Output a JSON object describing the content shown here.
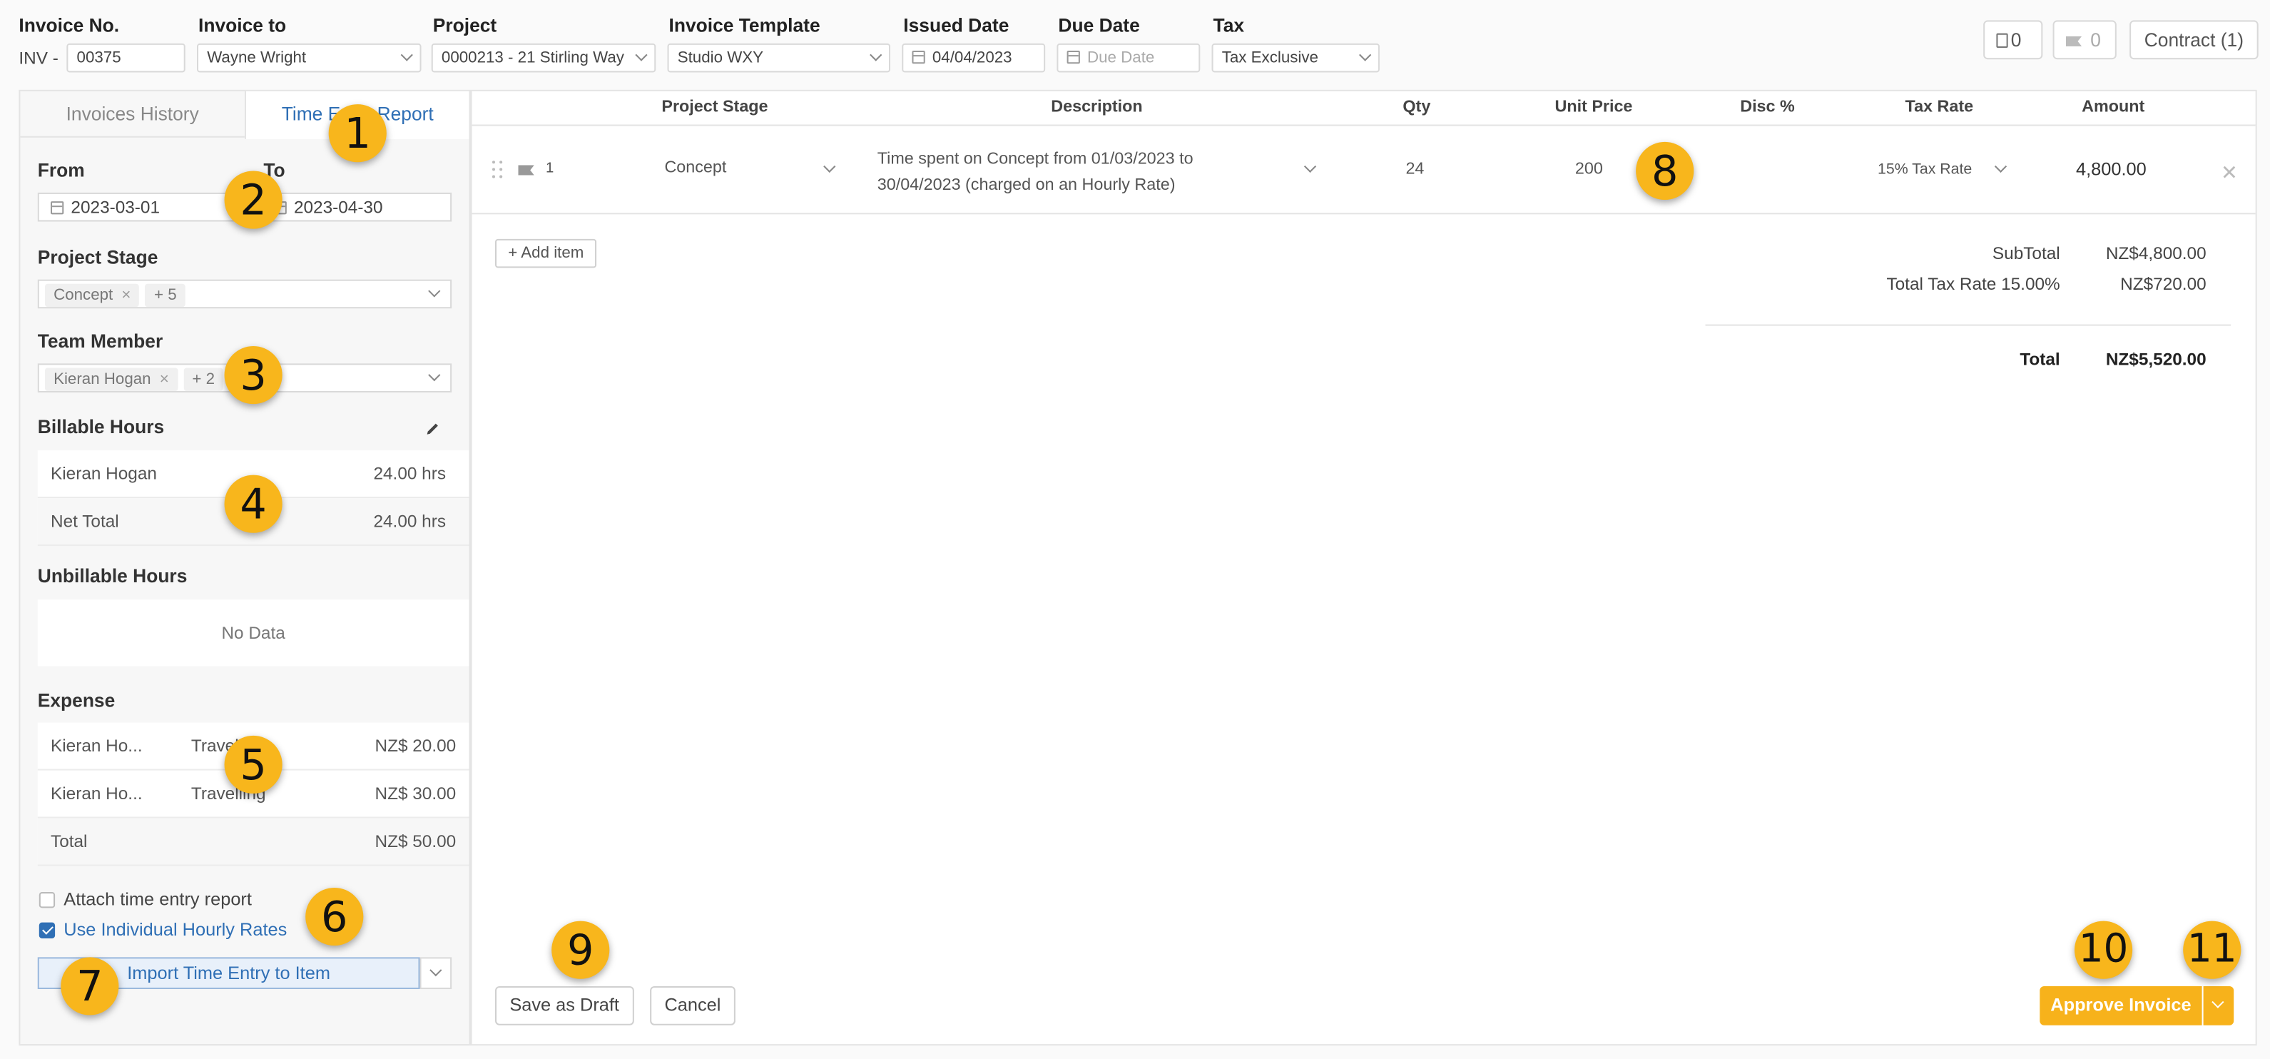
{
  "header": {
    "invoice_no_label": "Invoice No.",
    "invoice_prefix": "INV -",
    "invoice_no_value": "00375",
    "invoice_to_label": "Invoice to",
    "invoice_to_value": "Wayne Wright",
    "project_label": "Project",
    "project_value": "0000213 - 21 Stirling Way",
    "template_label": "Invoice Template",
    "template_value": "Studio WXY",
    "issued_label": "Issued Date",
    "issued_value": "04/04/2023",
    "due_label": "Due Date",
    "due_placeholder": "Due Date",
    "tax_label": "Tax",
    "tax_value": "Tax Exclusive",
    "doc_count": "0",
    "flag_count": "0",
    "contract_label": "Contract (1)"
  },
  "left": {
    "tabs": [
      "Invoices History",
      "Time Entry Report"
    ],
    "from_label": "From",
    "to_label": "To",
    "from_value": "2023-03-01",
    "to_value": "2023-04-30",
    "project_stage_label": "Project Stage",
    "project_stage_chip": "Concept",
    "project_stage_more": "+ 5",
    "team_member_label": "Team Member",
    "team_member_chip": "Kieran Hogan",
    "team_member_more": "+ 2",
    "billable_label": "Billable Hours",
    "billable_rows": [
      {
        "name": "Kieran Hogan",
        "hours": "24.00 hrs"
      },
      {
        "name": "Net Total",
        "hours": "24.00 hrs"
      }
    ],
    "unbillable_label": "Unbillable Hours",
    "unbillable_empty": "No Data",
    "expense_label": "Expense",
    "expense_rows": [
      {
        "name": "Kieran Ho...",
        "type": "Travelling",
        "amount": "NZ$ 20.00"
      },
      {
        "name": "Kieran Ho...",
        "type": "Travelling",
        "amount": "NZ$ 30.00"
      }
    ],
    "expense_total_label": "Total",
    "expense_total_value": "NZ$ 50.00",
    "attach_label": "Attach time entry report",
    "attach_checked": false,
    "individual_rates_label": "Use Individual Hourly Rates",
    "individual_rates_checked": true,
    "import_label": "Import Time Entry to Item"
  },
  "table": {
    "columns": [
      "Project Stage",
      "Description",
      "Qty",
      "Unit Price",
      "Disc %",
      "Tax Rate",
      "Amount"
    ],
    "rows": [
      {
        "no": "1",
        "stage": "Concept",
        "description_line1": "Time spent on Concept from 01/03/2023 to",
        "description_line2": "30/04/2023 (charged on an Hourly Rate)",
        "qty": "24",
        "unit_price": "200",
        "disc": "",
        "tax_rate": "15% Tax Rate",
        "amount": "4,800.00"
      }
    ],
    "add_item_label": "+ Add item"
  },
  "summary": {
    "subtotal_label": "SubTotal",
    "subtotal_value": "NZ$4,800.00",
    "tax_label": "Total Tax Rate 15.00%",
    "tax_value": "NZ$720.00",
    "total_label": "Total",
    "total_value": "NZ$5,520.00"
  },
  "actions": {
    "save_draft": "Save as Draft",
    "cancel": "Cancel",
    "approve": "Approve Invoice"
  },
  "markers": [
    "1",
    "2",
    "3",
    "4",
    "5",
    "6",
    "7",
    "8",
    "9",
    "10",
    "11"
  ],
  "colors": {
    "accent_blue": "#2f6fb5",
    "approve_orange": "#f7b21b",
    "marker_yellow": "#f8b61c"
  }
}
